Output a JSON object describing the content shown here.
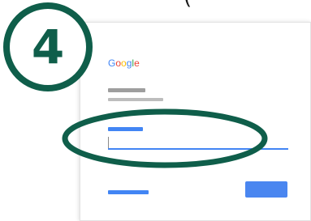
{
  "step": {
    "number": "4"
  },
  "top_fragment": "(",
  "login_card": {
    "brand": {
      "letters": [
        {
          "ch": "G",
          "color": "#4285F4"
        },
        {
          "ch": "o",
          "color": "#EA4335"
        },
        {
          "ch": "o",
          "color": "#FBBC05"
        },
        {
          "ch": "g",
          "color": "#4285F4"
        },
        {
          "ch": "l",
          "color": "#34A853"
        },
        {
          "ch": "e",
          "color": "#EA4335"
        }
      ]
    },
    "input": {
      "value": "",
      "state": "focused"
    }
  },
  "colors": {
    "accent_blue": "#4285F4",
    "badge_green": "#0F5E4A",
    "placeholder_gray": "#9E9E9E"
  }
}
